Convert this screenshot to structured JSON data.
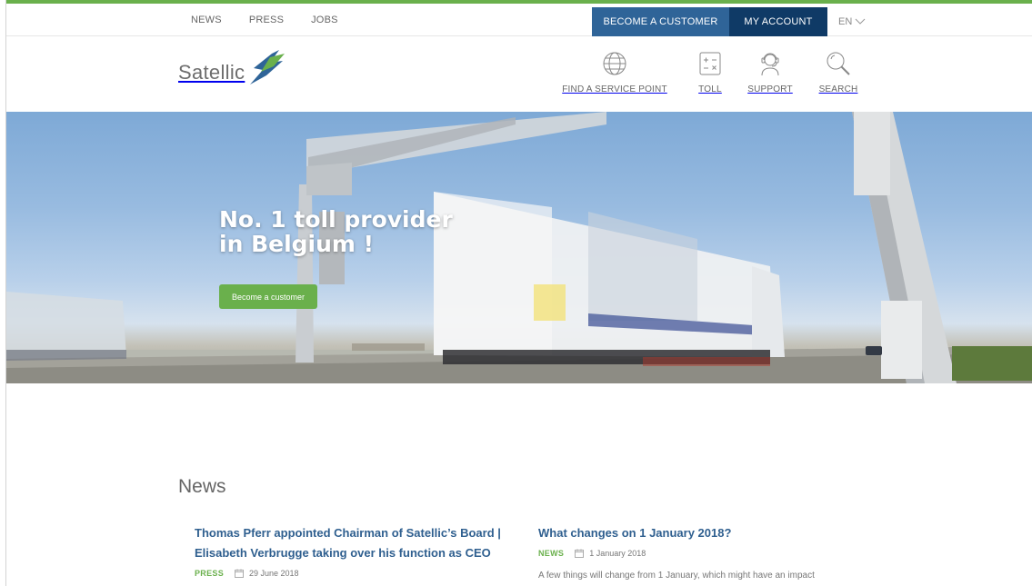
{
  "topbar": {
    "nav": [
      "NEWS",
      "PRESS",
      "JOBS"
    ],
    "become_customer": "BECOME A CUSTOMER",
    "my_account": "MY ACCOUNT",
    "language": "EN"
  },
  "header": {
    "logo_text": "Satellic",
    "nav": {
      "service_point": "FIND A SERVICE POINT",
      "toll": "TOLL",
      "support": "SUPPORT",
      "search": "SEARCH"
    }
  },
  "hero": {
    "title_line1": "No. 1 toll provider",
    "title_line2": "in Belgium !",
    "button": "Become a customer"
  },
  "news": {
    "heading": "News",
    "articles": [
      {
        "title_line1": "Thomas Pferr appointed Chairman of Satellic’s Board |",
        "title_line2": "Elisabeth Verbrugge taking over his function as CEO",
        "tag": "PRESS",
        "date": "29 June 2018"
      },
      {
        "title_line1": "What changes on 1 January 2018?",
        "tag": "NEWS",
        "date": "1 January 2018",
        "excerpt": "A few things will change from 1 January, which might have an impact"
      }
    ]
  },
  "colors": {
    "accent_green": "#6ab04c",
    "brand_blue": "#2f6498",
    "navy": "#0f3a66",
    "title_blue": "#2f5f8f"
  }
}
